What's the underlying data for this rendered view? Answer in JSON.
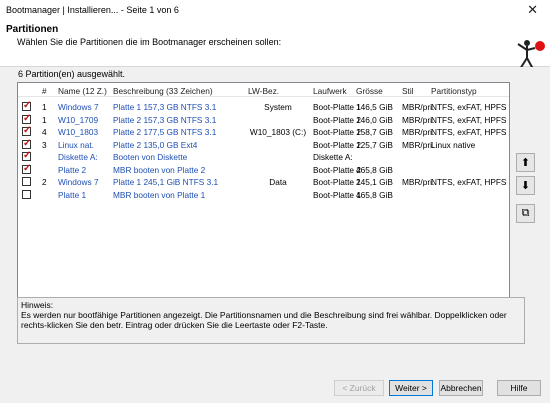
{
  "window": {
    "title": "Bootmanager | Installieren...  -  Seite 1 von 6",
    "close_glyph": "✕"
  },
  "header": {
    "title": "Partitionen",
    "subtitle": "Wählen Sie die Partitionen die im Bootmanager erscheinen sollen:"
  },
  "count_label": "6 Partition(en) ausgewählt.",
  "table": {
    "columns": [
      "#",
      "Name (12 Z.)",
      "Beschreibung (33 Zeichen)",
      "LW-Bez.",
      "Laufwerk",
      "Grösse",
      "Stil",
      "Partitionstyp"
    ],
    "rows": [
      {
        "checked": true,
        "num": "1",
        "name": "Windows 7",
        "desc": "Platte 1    157,3 GB    NTFS 3.1",
        "lw": "System",
        "drive": "Boot-Platte 1",
        "size": "146,5 GiB",
        "style": "MBR/pri.",
        "type": "NTFS, exFAT, HPFS"
      },
      {
        "checked": true,
        "num": "1",
        "name": "W10_1709",
        "desc": "Platte 2    157,3 GB    NTFS 3.1",
        "lw": "",
        "drive": "Boot-Platte 2",
        "size": "146,0 GiB",
        "style": "MBR/pri.",
        "type": "NTFS, exFAT, HPFS"
      },
      {
        "checked": true,
        "num": "4",
        "name": "W10_1803",
        "desc": "Platte 2    177,5 GB    NTFS 3.1",
        "lw": "W10_1803 (C:)",
        "drive": "Boot-Platte 2",
        "size": "158,7 GiB",
        "style": "MBR/pri.",
        "type": "NTFS, exFAT, HPFS"
      },
      {
        "checked": true,
        "num": "3",
        "name": "Linux nat.",
        "desc": "Platte 2    135,0 GB    Ext4",
        "lw": "",
        "drive": "Boot-Platte 2",
        "size": "125,7 GiB",
        "style": "MBR/pri.",
        "type": "Linux native"
      },
      {
        "checked": true,
        "num": "",
        "name": "Diskette A:",
        "desc": "Booten von Diskette",
        "lw": "",
        "drive": "Diskette A:",
        "size": "",
        "style": "",
        "type": ""
      },
      {
        "checked": true,
        "num": "",
        "name": "Platte 2",
        "desc": "MBR booten von Platte 2",
        "lw": "",
        "drive": "Boot-Platte 2",
        "size": "465,8 GiB",
        "style": "",
        "type": ""
      },
      {
        "checked": false,
        "num": "2",
        "name": "Windows 7",
        "desc": "Platte 1    245,1 GiB    NTFS 3.1",
        "lw": "Data",
        "drive": "Boot-Platte 1",
        "size": "245,1 GiB",
        "style": "MBR/pri.",
        "type": "NTFS, exFAT, HPFS"
      },
      {
        "checked": false,
        "num": "",
        "name": "Platte 1",
        "desc": "MBR booten von Platte 1",
        "lw": "",
        "drive": "Boot-Platte 1",
        "size": "465,8 GiB",
        "style": "",
        "type": ""
      }
    ]
  },
  "side_buttons": {
    "up": "⬆",
    "down": "⬇",
    "copy": "⧉"
  },
  "hint": {
    "title": "Hinweis:",
    "text": "Es werden nur bootfähige Partitionen angezeigt. Die Partitionsnamen und die Beschreibung sind frei wählbar. Doppelklicken oder rechts-klicken Sie den betr. Eintrag oder drücken Sie die Leertaste oder F2-Taste."
  },
  "buttons": {
    "back": "< Zurück",
    "next": "Weiter >",
    "cancel": "Abbrechen",
    "help": "Hilfe"
  },
  "colors": {
    "accent": "#1f4fb4",
    "check": "#c01010"
  }
}
